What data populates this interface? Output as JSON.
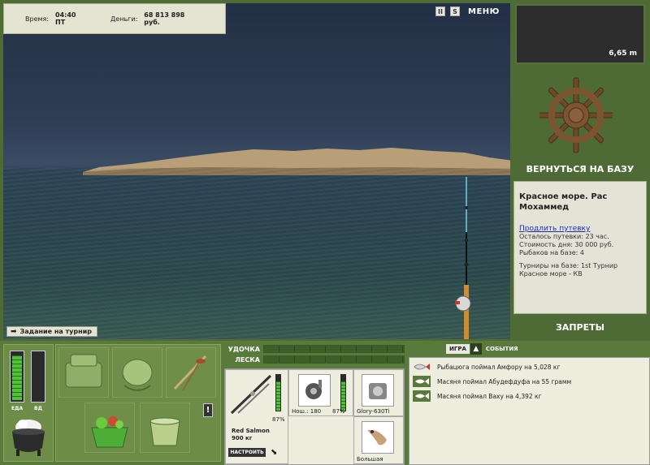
{
  "status_bar": {
    "time_label": "Время:",
    "time_value": "04:40 ПТ",
    "money_label": "Деньги:",
    "money_value": "68 813 898 руб."
  },
  "top_controls": {
    "pause_label": "II",
    "sound_label": "S",
    "menu_label": "МЕНЮ"
  },
  "depth": {
    "value": "6,65 m"
  },
  "base": {
    "return_label": "ВЕРНУТЬСЯ НА БАЗУ"
  },
  "location": {
    "title": "Красное море. Рас Мохаммед",
    "extend_link": "Продлить путевку",
    "lines": [
      "Осталось путевки: 23 час.",
      "Стоимость дня: 30 000 руб.",
      "Рыбаков на базе: 4",
      "Турниры на базе: 1st Турнир",
      "Красное море - КВ"
    ]
  },
  "bans": {
    "label": "ЗАПРЕТЫ"
  },
  "task": {
    "label": "Задание на турнир"
  },
  "meters": {
    "food_label": "ЕДА",
    "drink_label": "ВД",
    "food_level": 0.95,
    "drink_level": 0.0
  },
  "tackle": {
    "rod_label": "УДОЧКА",
    "line_label": "ЛЕСКА",
    "rod_name": "Red Salmon",
    "rod_weight": "900 кг",
    "rod_percent": "87%",
    "rod_level": 0.87,
    "reel_label": "Нош.: 180",
    "reel_percent": "87%",
    "reel_level": 0.87,
    "lure_name": "Glory-630Ti",
    "bait_name": "Большая",
    "setup_label": "НАСТРОИТЬ"
  },
  "events": {
    "tab_game": "ИГРА",
    "tab_events": "СОБЫТИЯ",
    "items": [
      "Рыбацюга поймал Амфору на 5,028 кг",
      "Масяня поймал Абудефдуфа на 55 грамм",
      "Масяня поймал Ваху на 4,392 кг"
    ]
  },
  "icons": {
    "pause": "pause-icon",
    "sound": "sound-icon",
    "helm": "ship-wheel-icon",
    "task_arrow": "arrow-right-icon",
    "pot": "pot-icon",
    "events_arrow": "arrow-up-icon"
  }
}
